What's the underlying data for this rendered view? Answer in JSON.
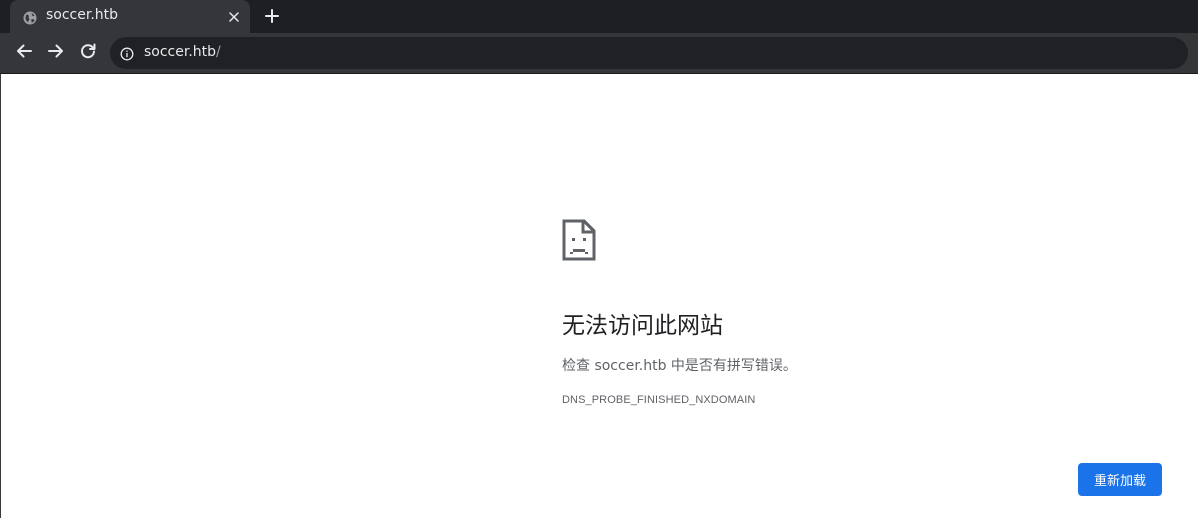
{
  "tab": {
    "title": "soccer.htb",
    "favicon": "globe-icon",
    "close_icon": "close-icon",
    "new_tab_icon": "plus-icon"
  },
  "toolbar": {
    "back_icon": "arrow-left-icon",
    "forward_icon": "arrow-right-icon",
    "reload_icon": "reload-icon",
    "site_info_icon": "info-icon",
    "url_host": "soccer.htb",
    "url_path": "/"
  },
  "error_page": {
    "icon": "sad-page-icon",
    "title": "无法访问此网站",
    "description": "检查 soccer.htb 中是否有拼写错误。",
    "code": "DNS_PROBE_FINISHED_NXDOMAIN",
    "reload_label": "重新加载"
  },
  "colors": {
    "tabstrip_bg": "#1e1f24",
    "toolbar_bg": "#35363a",
    "omnibox_bg": "#202124",
    "accent": "#1a73e8",
    "title_text": "#202124",
    "secondary_text": "#5f6368"
  }
}
